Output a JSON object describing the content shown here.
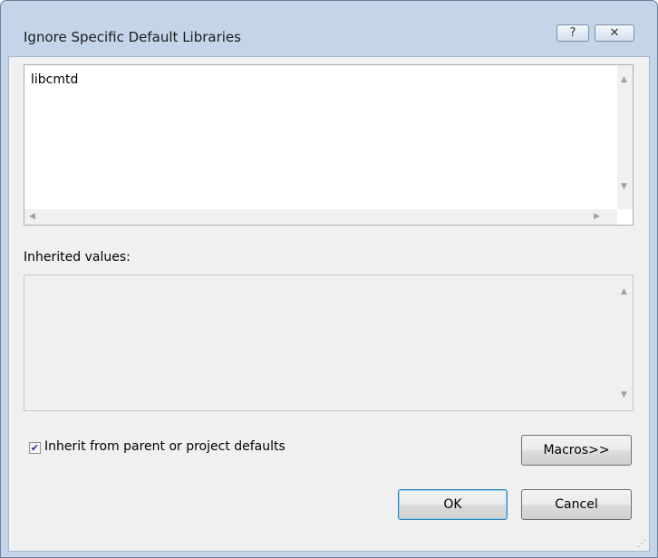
{
  "window": {
    "title": "Ignore Specific Default Libraries",
    "help_label": "?",
    "close_label": "✕"
  },
  "editor": {
    "items": [
      "libcmtd"
    ]
  },
  "inherited": {
    "label": "Inherited values:",
    "items": []
  },
  "inherit_checkbox": {
    "label": "Inherit from parent or project defaults",
    "checked": true
  },
  "buttons": {
    "macros": "Macros>>",
    "ok": "OK",
    "cancel": "Cancel"
  },
  "icons": {
    "scroll_up": "up-arrow-icon",
    "scroll_down": "down-arrow-icon",
    "scroll_left": "left-arrow-icon",
    "scroll_right": "right-arrow-icon",
    "resize_grip": "resize-grip-icon"
  }
}
